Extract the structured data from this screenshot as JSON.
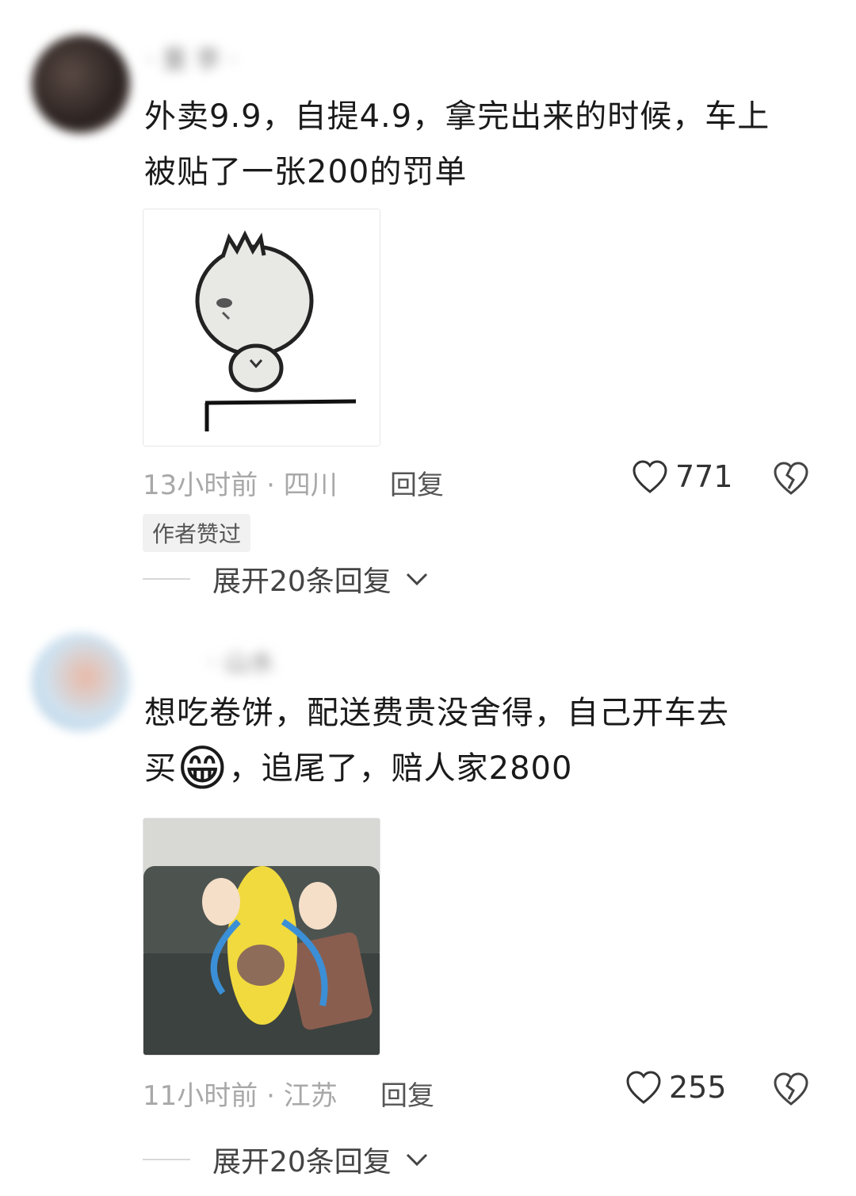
{
  "comments": [
    {
      "username": "· 重 李  ·",
      "text_line1": "外卖9.9，自提4.9，拿完出来的时候，车上",
      "text_line2": "被贴了一张200的罚单",
      "time": "13小时前",
      "location": "四川",
      "reply_label": "回复",
      "likes": "771",
      "badge": "作者赞过",
      "expand_label": "展开20条回复"
    },
    {
      "username": "· 山水",
      "text_line1": "想吃卷饼，配送费贵没舍得，自己开车去",
      "text_line2_a": "买",
      "text_line2_b": "，追尾了，赔人家2800",
      "emoji": "😁",
      "time": "11小时前",
      "location": "江苏",
      "reply_label": "回复",
      "likes": "255",
      "expand_label": "展开20条回复"
    }
  ],
  "icons": [
    "heart-outline-icon",
    "broken-heart-icon",
    "chevron-down-icon"
  ],
  "colors": {
    "meta": "#a8a8a8",
    "badge_bg": "#f1f1f1"
  }
}
